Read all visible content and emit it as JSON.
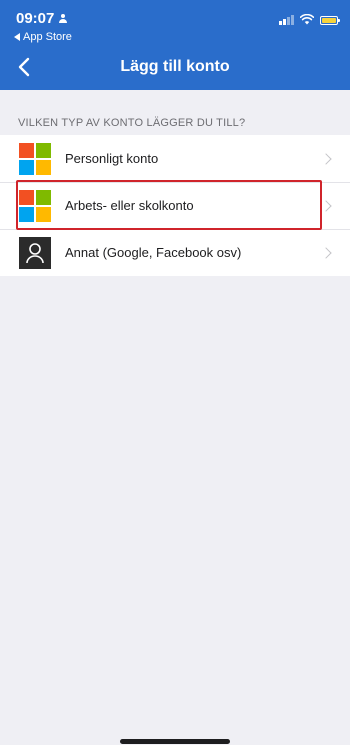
{
  "status_bar": {
    "time": "09:07",
    "back_app_label": "App Store"
  },
  "nav": {
    "title": "Lägg till konto"
  },
  "section": {
    "header": "VILKEN TYP AV KONTO LÄGGER DU TILL?"
  },
  "accounts": [
    {
      "label": "Personligt konto",
      "icon": "microsoft-logo-icon"
    },
    {
      "label": "Arbets- eller skolkonto",
      "icon": "microsoft-logo-icon",
      "highlighted": true
    },
    {
      "label": "Annat (Google, Facebook osv)",
      "icon": "person-icon"
    }
  ],
  "colors": {
    "header_bg": "#2a6dcb",
    "page_bg": "#efeff4",
    "highlight_border": "#d0242b",
    "battery": "#f7d33c"
  }
}
